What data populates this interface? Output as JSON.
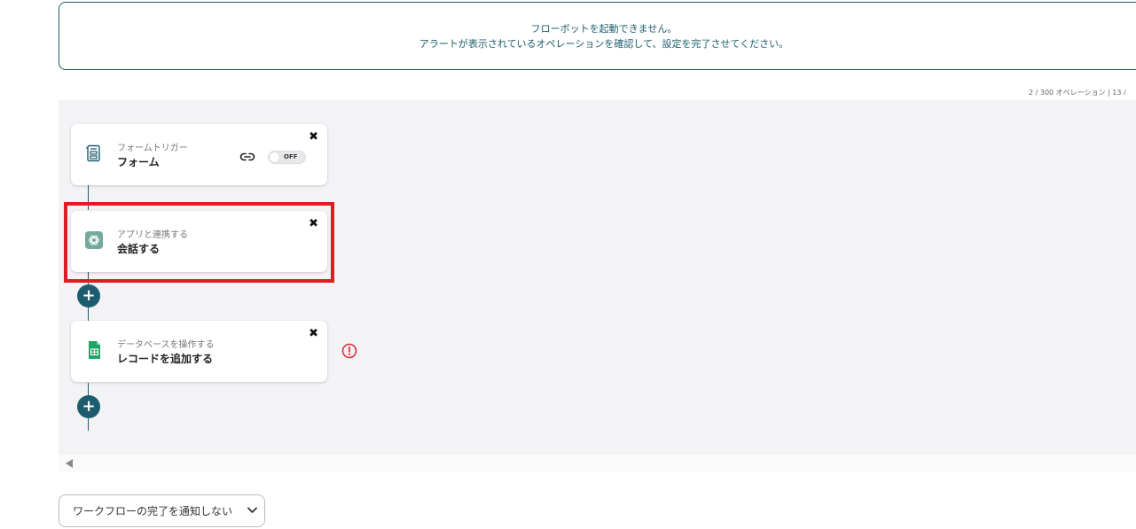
{
  "alert": {
    "line1": "フローボットを起動できません。",
    "line2": "アラートが表示されているオペレーションを確認して、設定を完了させてください。"
  },
  "op_counter": "2 / 300 オペレーション | 13 /",
  "nodes": [
    {
      "subtitle": "フォームトリガー",
      "title": "フォーム",
      "icon": "form-icon",
      "toggle": "OFF"
    },
    {
      "subtitle": "アプリと連携する",
      "title": "会話する",
      "icon": "chatgpt-icon"
    },
    {
      "subtitle": "データベースを操作する",
      "title": "レコードを追加する",
      "icon": "google-sheets-icon"
    }
  ],
  "close_symbol": "✖",
  "add_symbol": "+",
  "notify_select": {
    "value": "ワークフローの完了を通知しない"
  },
  "colors": {
    "accent": "#1d5c6e",
    "highlight": "#e01b24",
    "warning": "#e0303a",
    "sheets_green": "#1fa463",
    "chatgpt_bg": "#74aa9c"
  }
}
